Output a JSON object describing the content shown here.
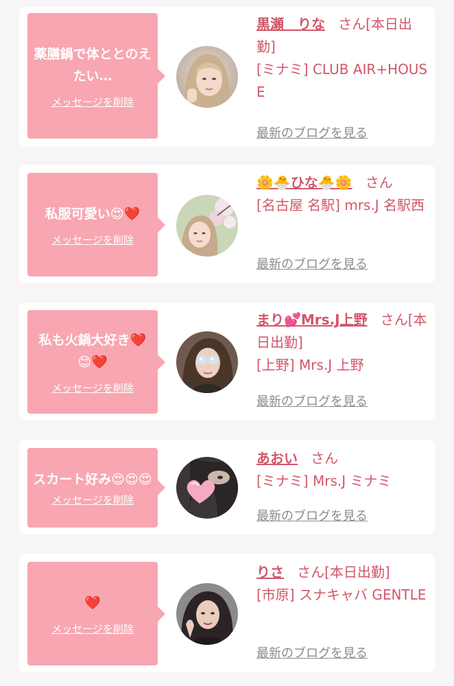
{
  "delete_label": "メッセージを削除",
  "blog_label": "最新のブログを見る",
  "honorific": "さん",
  "items": [
    {
      "message": "薬膳鍋で体ととのえたい…",
      "name": "黒瀬　りな",
      "status": "[本日出勤]",
      "shop": "[ミナミ] CLUB AIR+HOUSE"
    },
    {
      "message": "私服可愛い😍❤️",
      "name": "🌼🐣ひな🐣🌼",
      "status": "",
      "shop": "[名古屋 名駅] mrs.J 名駅西"
    },
    {
      "message": "私も火鍋大好き❤️😊❤️",
      "name": "まり💕Mrs.J上野",
      "status": "[本日出勤]",
      "shop": "[上野] Mrs.J 上野"
    },
    {
      "message": "スカート好み😍😍😍",
      "name": "あおい",
      "status": "",
      "shop": "[ミナミ] Mrs.J ミナミ"
    },
    {
      "message": "❤️",
      "name": "りさ",
      "status": "[本日出勤]",
      "shop": "[市原] スナキャバ GENTLE"
    }
  ]
}
